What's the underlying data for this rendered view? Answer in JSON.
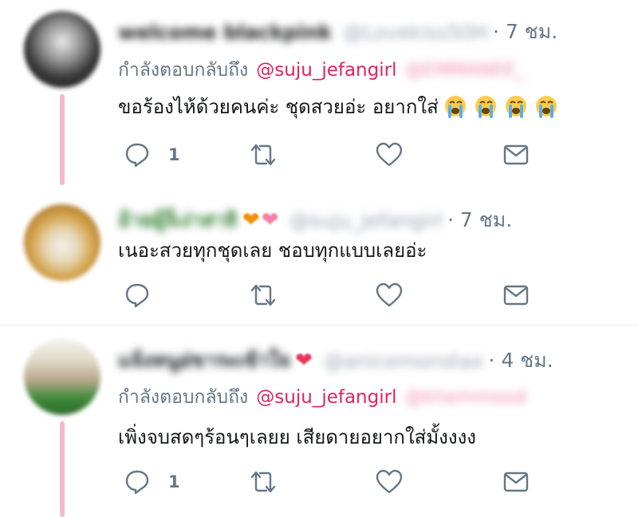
{
  "tweets": [
    {
      "name": "welcome blackpink",
      "handle": "@Lovekiss50H",
      "time": "· 7 ชม.",
      "reply_prefix": "กำลังตอบกลับถึง",
      "reply_mention": "@suju_jefangirl",
      "reply_mention_2": "@EMMANEE_",
      "text": "ขอร้องไห้ด้วยคนค่ะ ชุดสวยอ่ะ อยากใส่",
      "emoji": [
        "crying-face",
        "crying-face",
        "crying-face",
        "crying-face"
      ],
      "reply_count": "1",
      "avatar_color": "#2e2e2e"
    },
    {
      "name": "อ้ายผู้งี่เง่าสาธิ",
      "handle": "@suju_jefangirl",
      "time": "· 7 ชม.",
      "text": "เนอะสวยทุกชุดเลย ชอบทุกแบบเลยอ่ะ",
      "reply_count": "",
      "avatar_color": "#d49a3a"
    },
    {
      "name": "แจ้งหนูอ่ขาระเข้าใจ",
      "handle": "@anicemonstax",
      "time": "· 4 ชม.",
      "reply_prefix": "กำลังตอบกลับถึง",
      "reply_mention": "@suju_jefangirl",
      "reply_mention_2": "@khemmood",
      "text": "เพิ่งจบสดๆร้อนๆเลยย เสียดายอยากใส่มั้งงงง",
      "reply_count": "1",
      "avatar_color": "#c9b89a"
    }
  ],
  "colors": {
    "accent": "#e0245e",
    "muted": "#657786",
    "thread_line": "#f5b9cc",
    "divider": "#e6ecf0"
  }
}
